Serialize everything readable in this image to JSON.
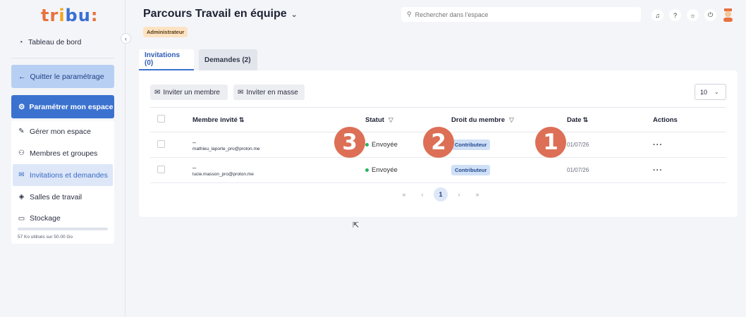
{
  "logo": {
    "text": "tribu:"
  },
  "sidebar": {
    "dashboard": "Tableau de bord",
    "quit": "Quitter le paramétrage",
    "configure": "Paramétrer mon espace",
    "items": [
      {
        "label": "Gérer mon espace",
        "icon": "wrench-icon"
      },
      {
        "label": "Membres et groupes",
        "icon": "users-icon"
      },
      {
        "label": "Invitations et demandes",
        "icon": "envelope-icon"
      },
      {
        "label": "Salles de travail",
        "icon": "cube-icon"
      },
      {
        "label": "Stockage",
        "icon": "folder-icon"
      }
    ],
    "storage_text": "57 Ko utilisés sur 50.00 Go"
  },
  "header": {
    "title": "Parcours Travail en équipe",
    "role": "Administrateur",
    "search_placeholder": "Rechercher dans l'espace"
  },
  "tabs": [
    {
      "label": "Invitations (0)"
    },
    {
      "label": "Demandes (2)"
    }
  ],
  "toolbar": {
    "invite_member": "Inviter un membre",
    "invite_bulk": "Inviter en masse",
    "per_page": "10"
  },
  "table": {
    "headers": {
      "member": "Membre invité",
      "status": "Statut",
      "role": "Droit du membre",
      "date": "Date",
      "actions": "Actions"
    },
    "rows": [
      {
        "name": "–",
        "email": "mathieu_laporte_pro@proton.me",
        "status": "Envoyée",
        "role": "Contributeur",
        "date": "01/07/26"
      },
      {
        "name": "–",
        "email": "lucie.masson_pro@proton.me",
        "status": "Envoyée",
        "role": "Contributeur",
        "date": "01/07/26"
      }
    ]
  },
  "pagination": {
    "first": "«",
    "prev": "‹",
    "current": "1",
    "next": "›",
    "last": "»"
  },
  "steps": [
    "3",
    "2",
    "1"
  ],
  "colors": {
    "primary": "#3b72cf",
    "accent": "#dc6f55",
    "status_green": "#27b45e"
  }
}
